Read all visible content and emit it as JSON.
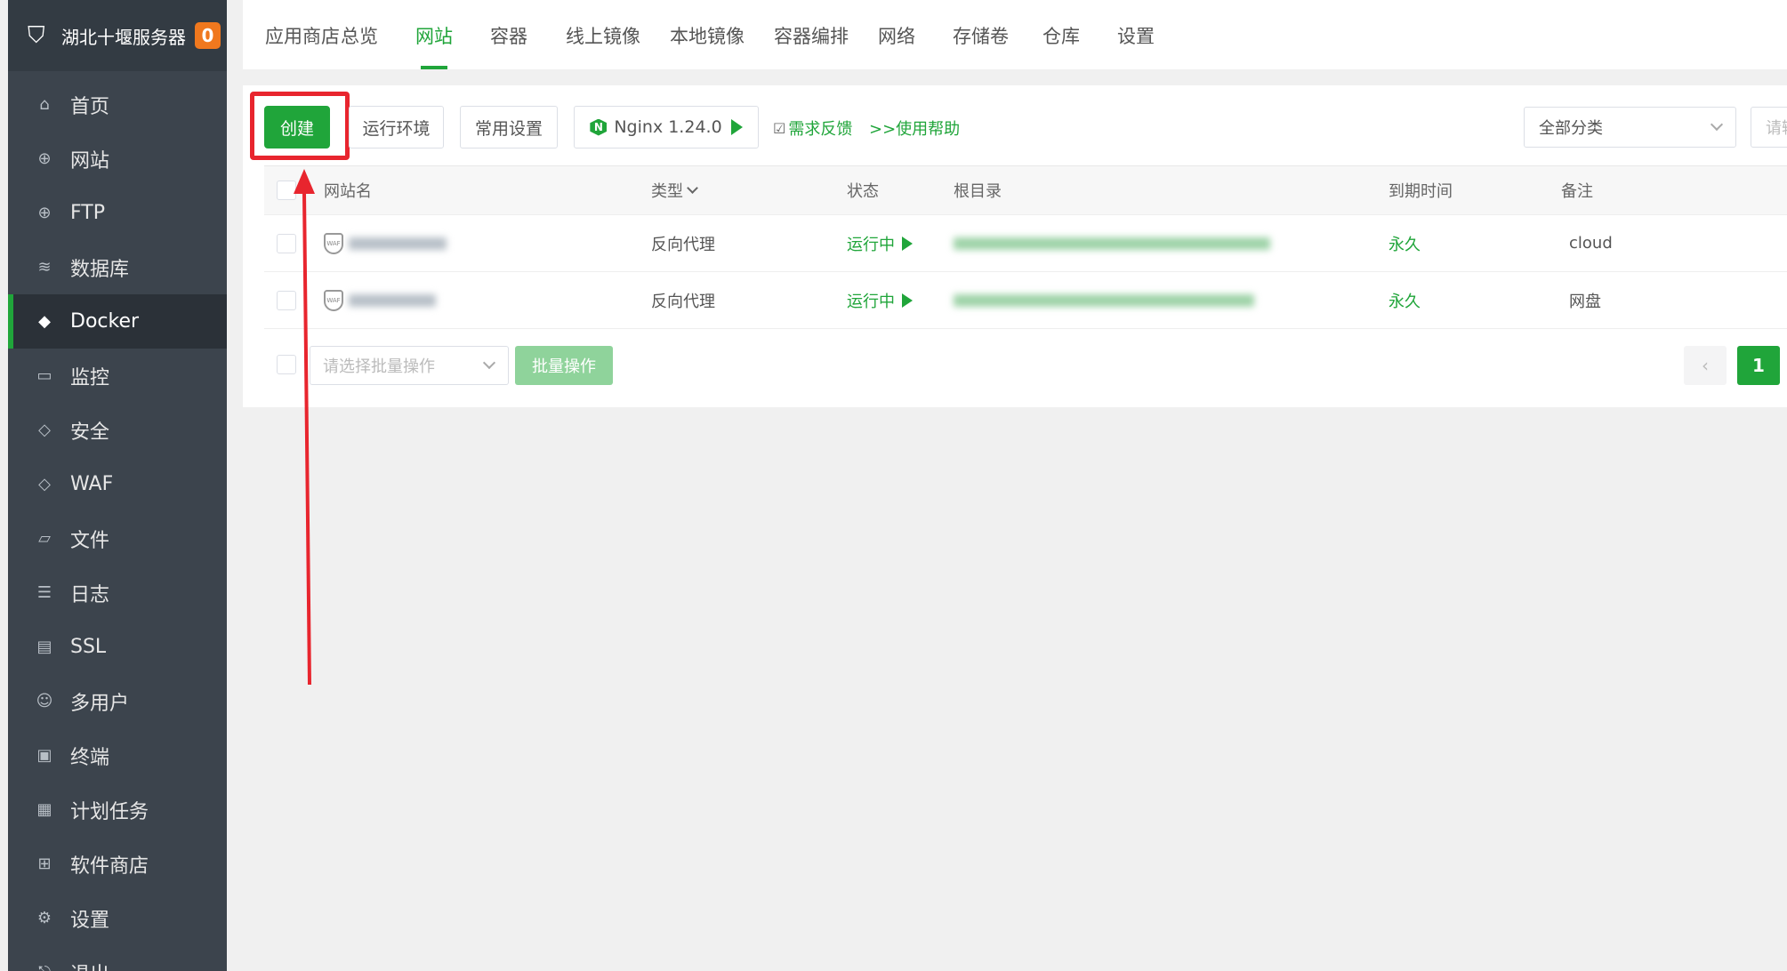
{
  "brand": {
    "name": "湖北十堰服务器",
    "badge": "0"
  },
  "sidebar": {
    "items": [
      {
        "label": "首页",
        "icon": "home-icon",
        "glyph": "⌂"
      },
      {
        "label": "网站",
        "icon": "globe-icon",
        "glyph": "⊕"
      },
      {
        "label": "FTP",
        "icon": "ftp-globe-icon",
        "glyph": "⊕"
      },
      {
        "label": "数据库",
        "icon": "database-icon",
        "glyph": "≋"
      },
      {
        "label": "Docker",
        "icon": "docker-icon",
        "glyph": "◆"
      },
      {
        "label": "监控",
        "icon": "monitor-icon",
        "glyph": "▭"
      },
      {
        "label": "安全",
        "icon": "shield-icon",
        "glyph": "◇"
      },
      {
        "label": "WAF",
        "icon": "waf-shield-icon",
        "glyph": "◇"
      },
      {
        "label": "文件",
        "icon": "folder-icon",
        "glyph": "▱"
      },
      {
        "label": "日志",
        "icon": "log-icon",
        "glyph": "☰"
      },
      {
        "label": "SSL",
        "icon": "ssl-certificate-icon",
        "glyph": "▤"
      },
      {
        "label": "多用户",
        "icon": "users-icon",
        "glyph": "☺"
      },
      {
        "label": "终端",
        "icon": "terminal-icon",
        "glyph": "▣"
      },
      {
        "label": "计划任务",
        "icon": "calendar-icon",
        "glyph": "▦"
      },
      {
        "label": "软件商店",
        "icon": "apps-grid-icon",
        "glyph": "⊞"
      },
      {
        "label": "设置",
        "icon": "gear-icon",
        "glyph": "⚙"
      },
      {
        "label": "退出",
        "icon": "logout-icon",
        "glyph": "⎋"
      }
    ],
    "active": "Docker"
  },
  "tabs": [
    {
      "label": "应用商店"
    },
    {
      "label": "总览"
    },
    {
      "label": "网站"
    },
    {
      "label": "容器"
    },
    {
      "label": "线上镜像"
    },
    {
      "label": "本地镜像"
    },
    {
      "label": "容器编排"
    },
    {
      "label": "网络"
    },
    {
      "label": "存储卷"
    },
    {
      "label": "仓库"
    },
    {
      "label": "设置"
    }
  ],
  "active_tab": "网站",
  "toolbar": {
    "create": "创建",
    "runtime": "运行环境",
    "common_settings": "常用设置",
    "nginx": "Nginx 1.24.0",
    "feedback": "需求反馈",
    "help": ">>使用帮助",
    "category": "全部分类",
    "search_placeholder": "请输入"
  },
  "table": {
    "headers": {
      "name": "网站名",
      "type": "类型",
      "status": "状态",
      "root": "根目录",
      "expire": "到期时间",
      "remark": "备注"
    },
    "rows": [
      {
        "type": "反向代理",
        "status": "运行中",
        "expire": "永久",
        "remark": "cloud"
      },
      {
        "type": "反向代理",
        "status": "运行中",
        "expire": "永久",
        "remark": "网盘"
      }
    ]
  },
  "footer": {
    "batch_placeholder": "请选择批量操作",
    "batch_button": "批量操作",
    "prev": "‹",
    "current_page": "1"
  },
  "colors": {
    "accent": "#20a53a",
    "sidebar_bg": "#3c444d",
    "annotation": "#e8252e",
    "badge": "#f0781e"
  }
}
